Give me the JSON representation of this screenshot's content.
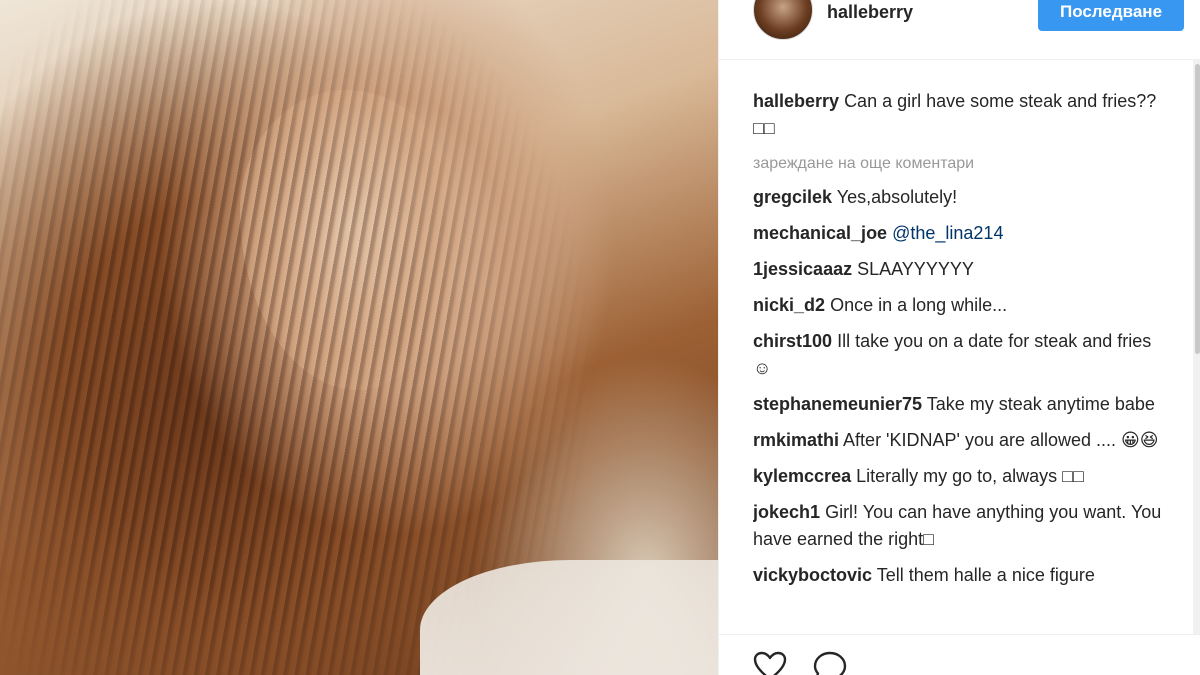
{
  "header": {
    "username": "halleberry",
    "follow_label": "Последване"
  },
  "caption": {
    "username": "halleberry",
    "text": "Can a girl have some steak and fries?? □□"
  },
  "load_more_label": "зареждане на още коментари",
  "comments": [
    {
      "username": "gregcilek",
      "text": "Yes,absolutely!"
    },
    {
      "username": "mechanical_joe",
      "text": "@the_lina214"
    },
    {
      "username": "1jessicaaaz",
      "text": "SLAAYYYYYY"
    },
    {
      "username": "nicki_d2",
      "text": "Once in a long while..."
    },
    {
      "username": "chirst100",
      "text": "Ill take you on a date for steak and fries☺"
    },
    {
      "username": "stephanemeunier75",
      "text": "Take my steak anytime babe"
    },
    {
      "username": "rmkimathi",
      "text": "After 'KIDNAP' you are allowed .... 😀😆"
    },
    {
      "username": "kylemccrea",
      "text": "Literally my go to, always □□"
    },
    {
      "username": "jokech1",
      "text": "Girl! You can have anything you want. You have earned the right□"
    },
    {
      "username": "vickyboctovic",
      "text": "Tell them halle a nice figure"
    }
  ],
  "actions": {
    "like_icon": "heart-icon",
    "comment_icon": "comment-bubble-icon"
  },
  "colors": {
    "accent": "#3897f0",
    "text": "#262626",
    "muted": "#999999",
    "mention": "#003569"
  }
}
